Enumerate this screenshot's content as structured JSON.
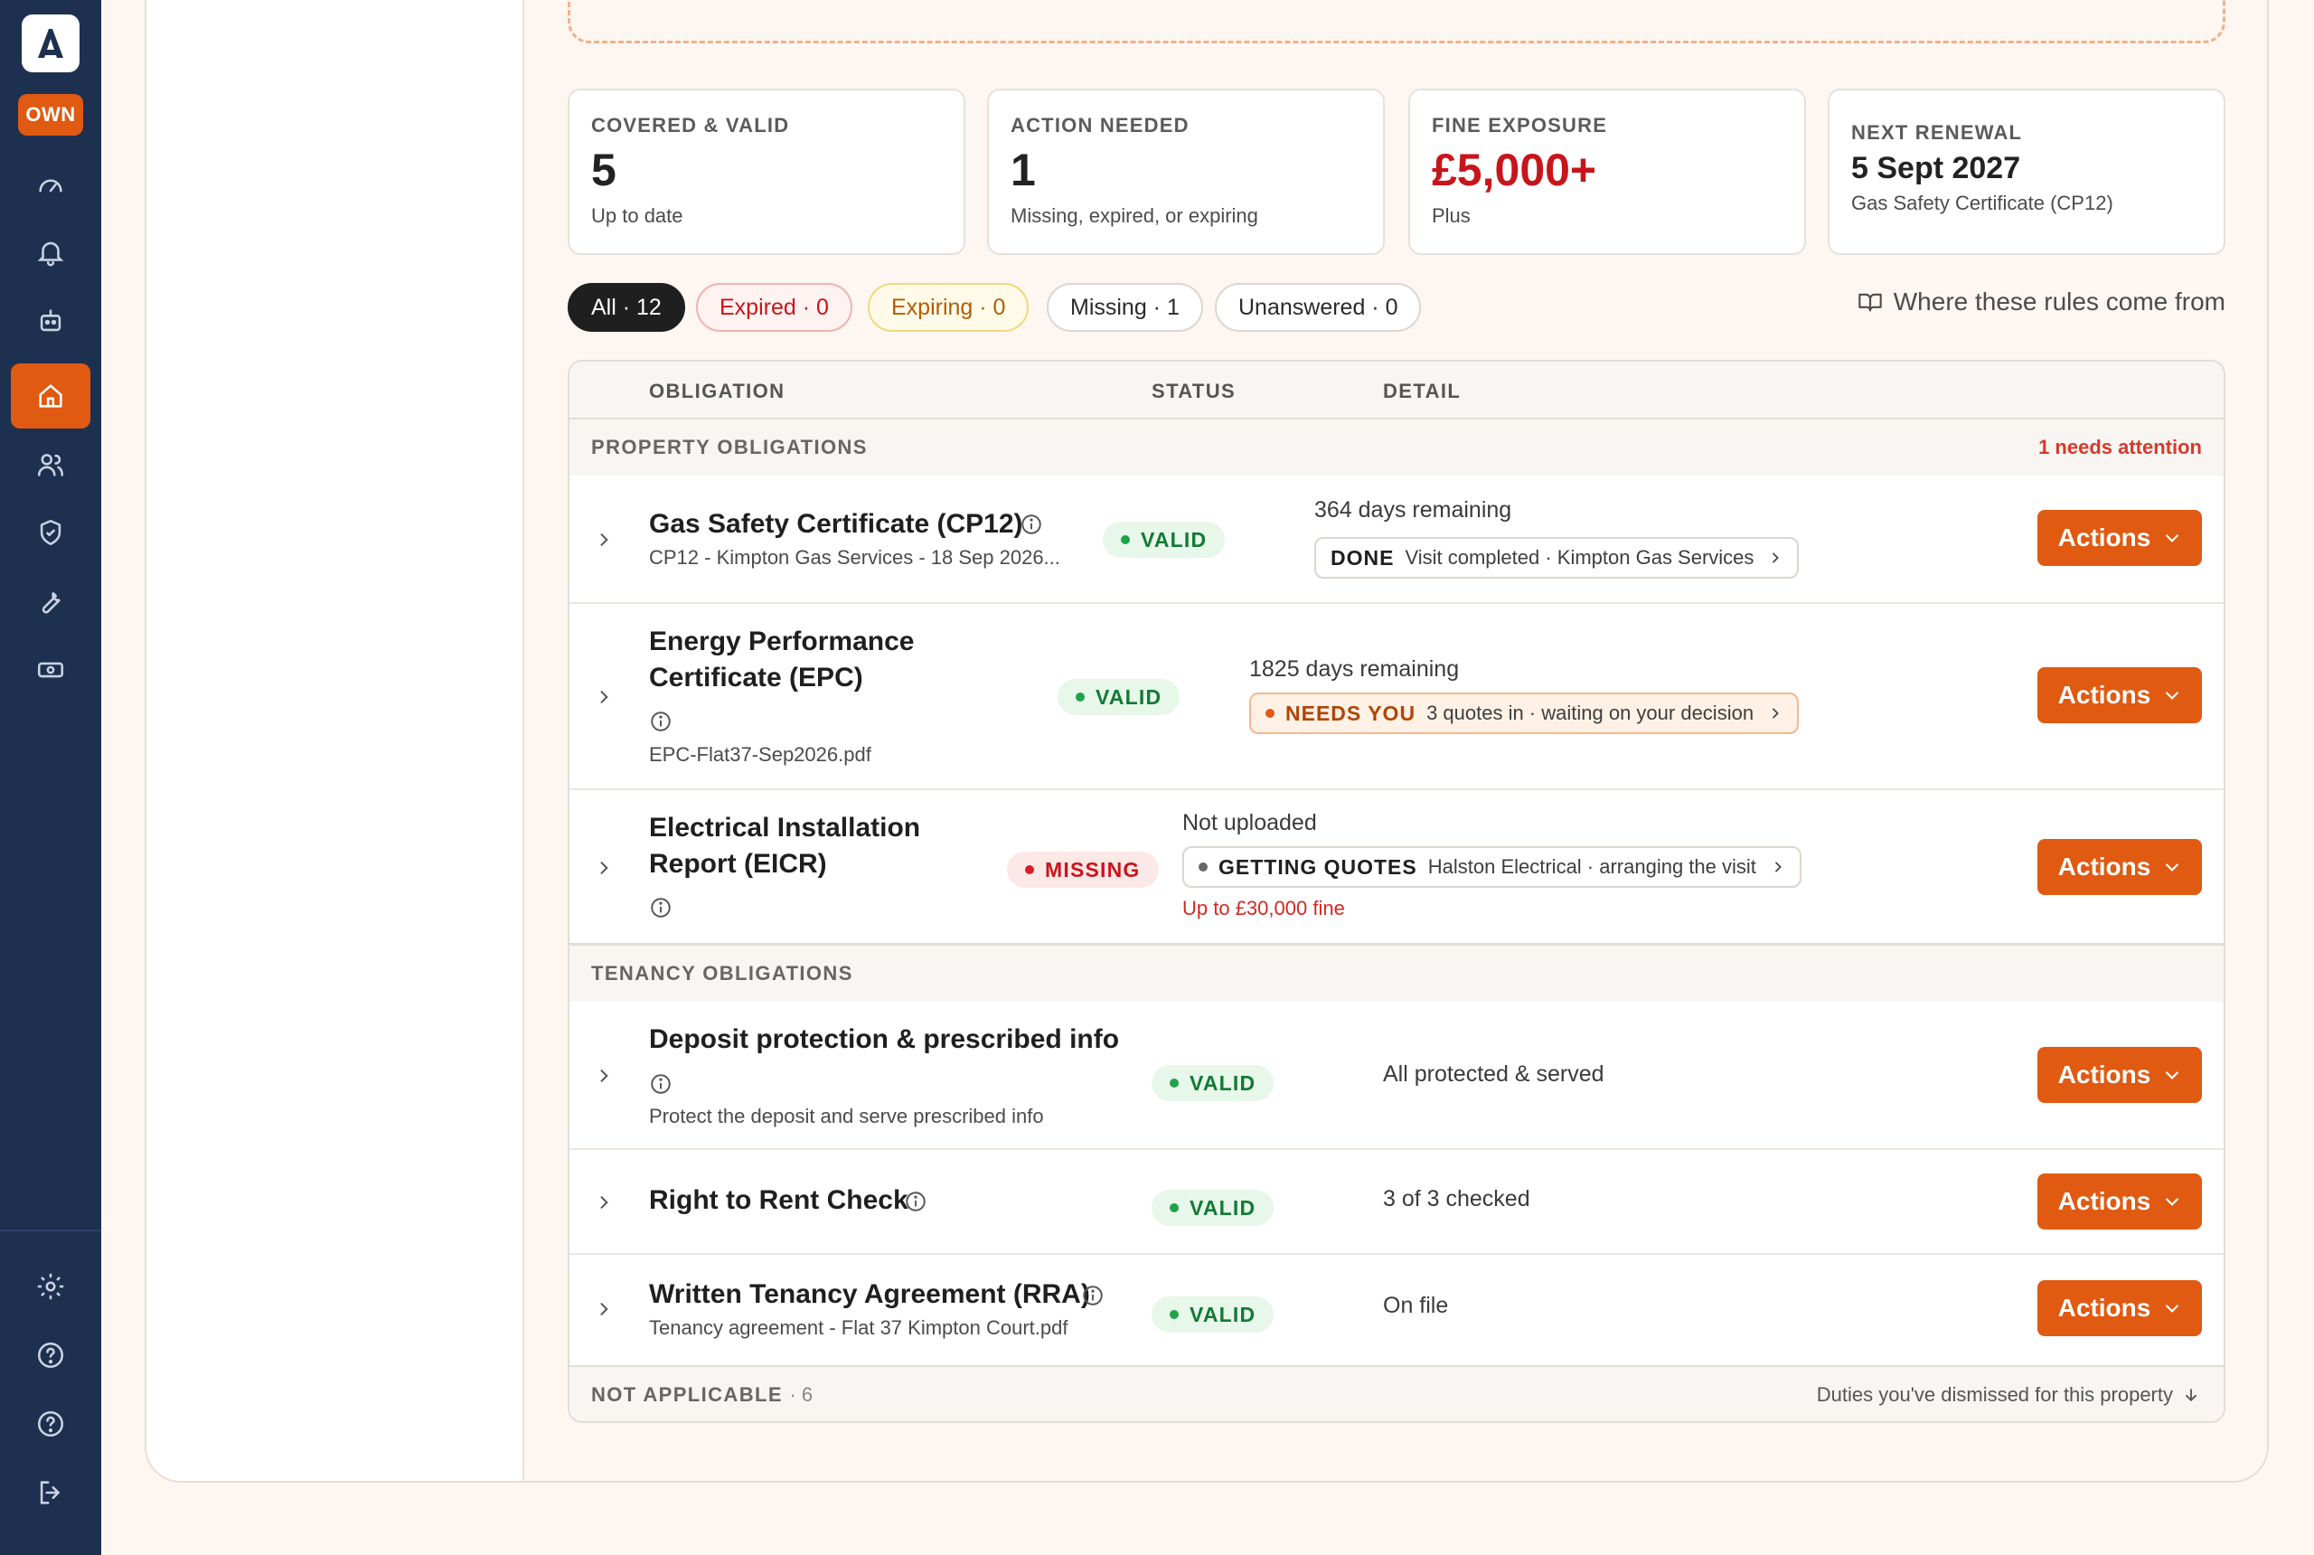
{
  "sidebar": {
    "logo_letter": "A",
    "badge": "OWN",
    "nav": [
      {
        "icon": "gauge-icon"
      },
      {
        "icon": "bell-icon"
      },
      {
        "icon": "robot-icon"
      },
      {
        "icon": "home-icon",
        "active": true
      },
      {
        "icon": "users-icon"
      },
      {
        "icon": "shield-check-icon"
      },
      {
        "icon": "wrench-icon"
      },
      {
        "icon": "banknote-icon"
      }
    ],
    "bottom_nav": [
      {
        "icon": "gear-icon"
      },
      {
        "icon": "help-icon"
      },
      {
        "icon": "question-icon"
      },
      {
        "icon": "logout-icon"
      }
    ],
    "accent": "#e05a12",
    "background": "#1e3050"
  },
  "stats": [
    {
      "label": "COVERED & VALID",
      "value": "5",
      "sub": "Up to date"
    },
    {
      "label": "ACTION NEEDED",
      "value": "1",
      "sub": "Missing, expired, or expiring"
    },
    {
      "label": "FINE EXPOSURE",
      "value": "£5,000+",
      "sub": "Plus"
    },
    {
      "label": "NEXT RENEWAL",
      "value": "5 Sept 2027",
      "sub": "Gas Safety Certificate (CP12)"
    }
  ],
  "filters": {
    "all": "All · 12",
    "expired": "Expired · 0",
    "expiring": "Expiring · 0",
    "missing": "Missing · 1",
    "unanswered": "Unanswered · 0",
    "rules_link": "Where these rules come from"
  },
  "table": {
    "headers": {
      "obligation": "OBLIGATION",
      "status": "STATUS",
      "detail": "DETAIL"
    },
    "property_section": {
      "title": "PROPERTY OBLIGATIONS",
      "note": "1 needs attention"
    },
    "tenancy_section": {
      "title": "TENANCY OBLIGATIONS"
    },
    "actions_label": "Actions",
    "rows": {
      "gas": {
        "title": "Gas Safety Certificate (CP12)",
        "sub": "CP12 - Kimpton Gas Services - 18 Sep 2026...",
        "status": "VALID",
        "detail": "364 days remaining",
        "pill_label": "DONE",
        "pill_text": "Visit completed · Kimpton Gas Services"
      },
      "epc": {
        "title_line1": "Energy Performance",
        "title_line2": "Certificate (EPC)",
        "sub": "EPC-Flat37-Sep2026.pdf",
        "status": "VALID",
        "detail": "1825 days remaining",
        "pill_label": "NEEDS YOU",
        "pill_text": "3 quotes in · waiting on your decision"
      },
      "eicr": {
        "title_line1": "Electrical Installation",
        "title_line2": "Report (EICR)",
        "status": "MISSING",
        "detail": "Not uploaded",
        "pill_label": "GETTING QUOTES",
        "pill_text": "Halston Electrical · arranging the visit",
        "fine": "Up to £30,000 fine"
      },
      "deposit": {
        "title": "Deposit protection & prescribed info",
        "sub": "Protect the deposit and serve prescribed info",
        "status": "VALID",
        "detail": "All protected & served"
      },
      "rtr": {
        "title": "Right to Rent Check",
        "status": "VALID",
        "detail": "3 of 3 checked"
      },
      "rra": {
        "title": "Written Tenancy Agreement (RRA)",
        "sub": "Tenancy agreement - Flat 37 Kimpton Court.pdf",
        "status": "VALID",
        "detail": "On file"
      }
    },
    "footer": {
      "title": "NOT APPLICABLE",
      "count": "· 6",
      "link": "Duties you've dismissed for this property"
    }
  }
}
